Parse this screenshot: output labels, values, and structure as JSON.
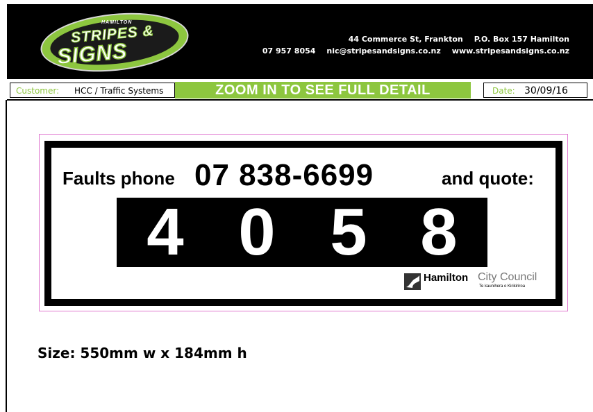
{
  "header": {
    "logo": {
      "small_text": "HAMILTON",
      "line1": "STRIPES &",
      "line2": "SIGNS"
    },
    "address": "44 Commerce St, Frankton",
    "po_box": "P.O. Box 157 Hamilton",
    "phone": "07 957 8054",
    "email": "nic@stripesandsigns.co.nz",
    "website": "www.stripesandsigns.co.nz"
  },
  "infobar": {
    "customer_label": "Customer:",
    "customer_value": "HCC / Traffic Systems",
    "zoom_banner": "ZOOM IN TO SEE FULL DETAIL",
    "date_label": "Date:",
    "date_value": "30/09/16"
  },
  "sign": {
    "faults_label": "Faults phone",
    "faults_number": "07 838-6699",
    "quote_label": "and quote:",
    "code_digits": [
      "4",
      "0",
      "5",
      "8"
    ],
    "council_logo": {
      "name": "Hamilton",
      "council": "City Council",
      "subtitle": "Te kaunihera o Kirikiriroa"
    }
  },
  "size_text": "Size: 550mm w x 184mm h",
  "colors": {
    "brand_green": "#8dc63f",
    "header_bg": "#000000",
    "proof_border": "#e07ad0"
  }
}
